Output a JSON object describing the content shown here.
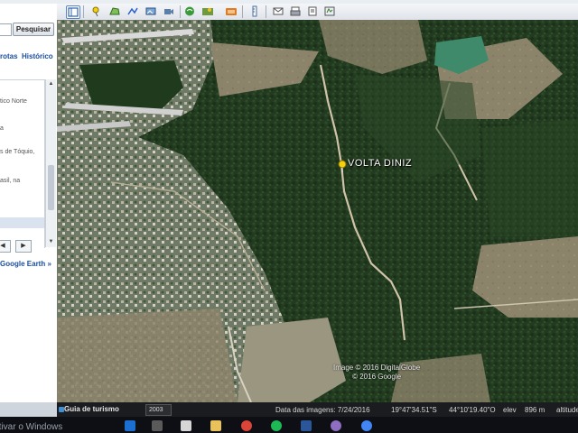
{
  "sidebar": {
    "search_button": "Pesquisar",
    "tabs": [
      {
        "label": "rotas"
      },
      {
        "label": "Histórico"
      }
    ],
    "list_items": [
      "tico Norte",
      "a",
      "s de Tóquio,",
      "asil, na"
    ],
    "prev_label": "◀",
    "next_label": "▶",
    "google_earth_link": "Google Earth »"
  },
  "map": {
    "place_label": "VOLTA DINIZ",
    "copyright_line1": "Image © 2016 DigitalGlobe",
    "copyright_line2": "© 2016 Google"
  },
  "statusbar": {
    "tour_guide": "Guia de turismo",
    "history_year": "2003",
    "imagery_date": "Data das imagens: 7/24/2016",
    "lat": "19°47'34.51\"S",
    "lon": "44°10'19.40\"O",
    "elev_label": "elev",
    "elev_value": "896 m",
    "eye_alt": "altitude"
  },
  "taskbar": {
    "watermark": "Ativar o Windows"
  },
  "colors": {
    "forest": "#233a1f",
    "field": "#8c836b",
    "road": "#cfc3a8",
    "accent": "#1a4fa0"
  }
}
